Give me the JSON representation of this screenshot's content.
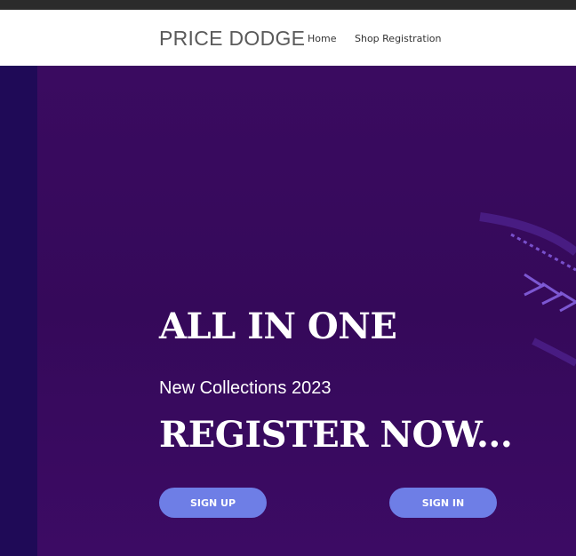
{
  "nav": {
    "brand": "PRICE DODGE",
    "links": [
      {
        "label": "Home"
      },
      {
        "label": "Shop Registration"
      }
    ]
  },
  "hero": {
    "heading": "ALL IN ONE",
    "subheading": "New Collections 2023",
    "cta_text": "REGISTER NOW...",
    "buttons": {
      "sign_up": "SIGN UP",
      "sign_in": "SIGN IN"
    }
  },
  "colors": {
    "topbar": "#2b2b2b",
    "hero_background": "#35095a",
    "button": "#6e7ee6"
  }
}
